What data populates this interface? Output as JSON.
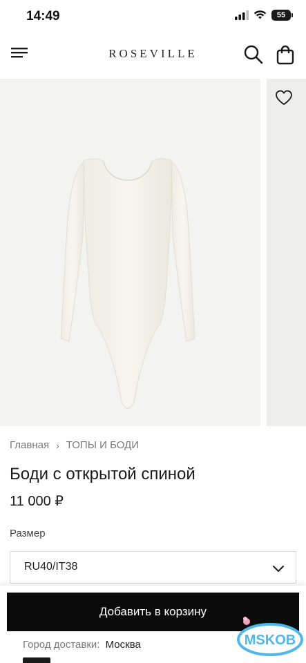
{
  "status_bar": {
    "time": "14:49",
    "battery": "55"
  },
  "header": {
    "logo": "ROSEVILLE"
  },
  "breadcrumb": {
    "home": "Главная",
    "separator": "›",
    "category": "ТОПЫ И БОДИ"
  },
  "product": {
    "title": "Боди с открытой спиной",
    "price": "11 000 ₽"
  },
  "size": {
    "label": "Размер",
    "selected": "RU40/IT38"
  },
  "cart": {
    "button_label": "Добавить в корзину"
  },
  "delivery": {
    "label": "Город доставки:",
    "city": "Москва"
  },
  "watermark": {
    "text": "MSKOB"
  },
  "colors": {
    "accent": "#0b0b0b",
    "watermark": "#4fb8e8"
  }
}
